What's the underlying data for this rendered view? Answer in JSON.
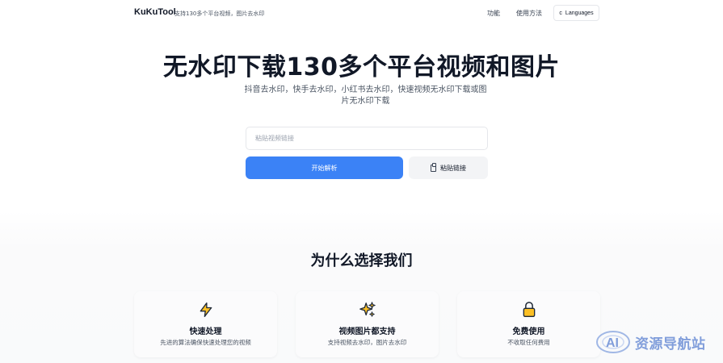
{
  "nav": {
    "brand": "KuKuTool",
    "tagline": "支持130多个平台视频，图片去水印",
    "links": [
      "功能",
      "使用方法"
    ],
    "language_label": "Languages",
    "language_icon": "globe-icon"
  },
  "hero": {
    "title": "无水印下载130多个平台视频和图片",
    "subtitle": "抖音去水印，快手去水印，小红书去水印，快速视频无水印下载或图片无水印下载",
    "input_placeholder": "粘贴视频链接",
    "input_value": "",
    "parse_button": "开始解析",
    "paste_button": "粘贴链接",
    "paste_icon": "clipboard-icon"
  },
  "features": {
    "title": "为什么选择我们",
    "cards": [
      {
        "icon": "lightning-icon",
        "title": "快速处理",
        "desc": "先进的算法确保快速处理您的视频"
      },
      {
        "icon": "sparkles-icon",
        "title": "视频图片都支持",
        "desc": "支持视频去水印，图片去水印"
      },
      {
        "icon": "lock-icon",
        "title": "免费使用",
        "desc": "不收取任何费用"
      }
    ]
  },
  "watermark": {
    "text": "资源导航站",
    "logo_letters": "AI"
  },
  "colors": {
    "primary": "#3b82f6",
    "text": "#111827",
    "muted": "#4b5563",
    "icon_yellow": "#fbbf24"
  }
}
